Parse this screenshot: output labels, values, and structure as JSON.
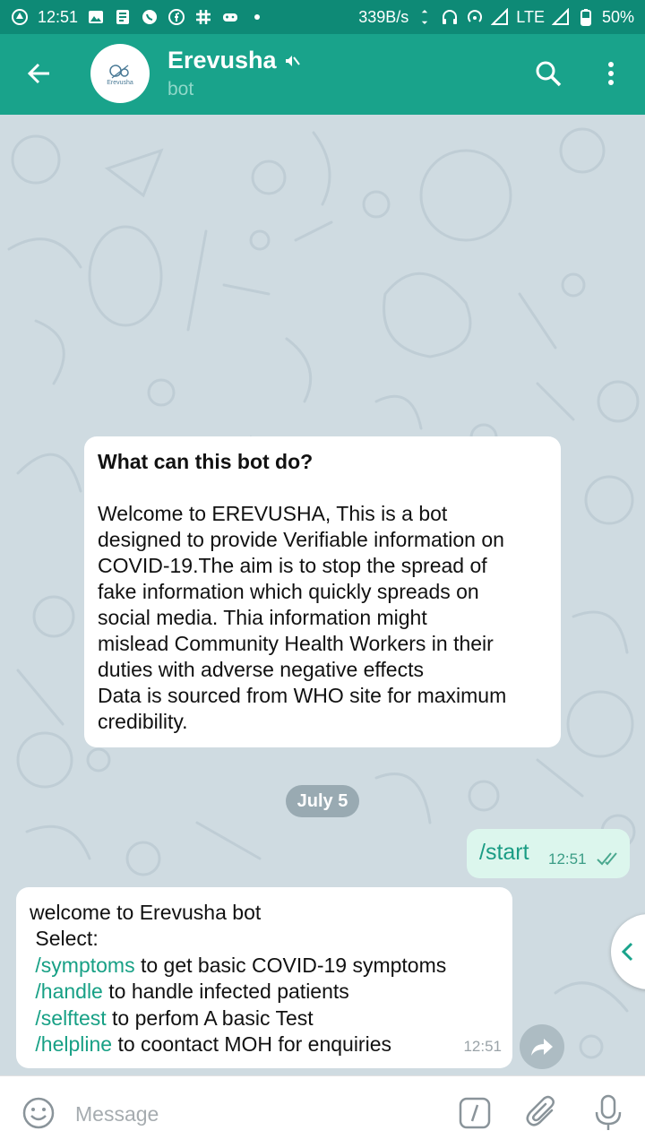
{
  "status_bar": {
    "time": "12:51",
    "net_speed": "339B/s",
    "network": "LTE",
    "battery": "50%"
  },
  "header": {
    "title": "Erevusha",
    "subtitle": "bot",
    "avatar_text": "Erevusha"
  },
  "messages": {
    "info_title": "What can this bot do?",
    "info_body": "Welcome to EREVUSHA, This is a bot\ndesigned to provide Verifiable information on\nCOVID-19.The aim is to stop the spread of\nfake information which quickly spreads on\nsocial media. Thia information might\nmislead Community Health Workers in their\nduties with adverse negative effects\nData is sourced from WHO site for maximum\ncredibility.",
    "date_chip": "July 5",
    "outgoing": {
      "text": "/start",
      "time": "12:51"
    },
    "incoming": {
      "line1": "welcome to Erevusha bot",
      "line2": " Select:",
      "commands": [
        {
          "cmd": "/symptoms",
          "desc": " to get basic COVID-19 symptoms"
        },
        {
          "cmd": "/handle",
          "desc": " to handle infected patients"
        },
        {
          "cmd": "/selftest",
          "desc": " to perfom A basic Test"
        },
        {
          "cmd": "/helpline",
          "desc": " to coontact MOH for enquiries"
        }
      ],
      "time": "12:51"
    }
  },
  "input": {
    "placeholder": "Message"
  },
  "colors": {
    "status_bar": "#0e8a76",
    "app_bar": "#19a38b",
    "accent_text": "#17a085",
    "outgoing_bubble": "#dcf6ed",
    "chat_bg": "#cfdbe1"
  }
}
